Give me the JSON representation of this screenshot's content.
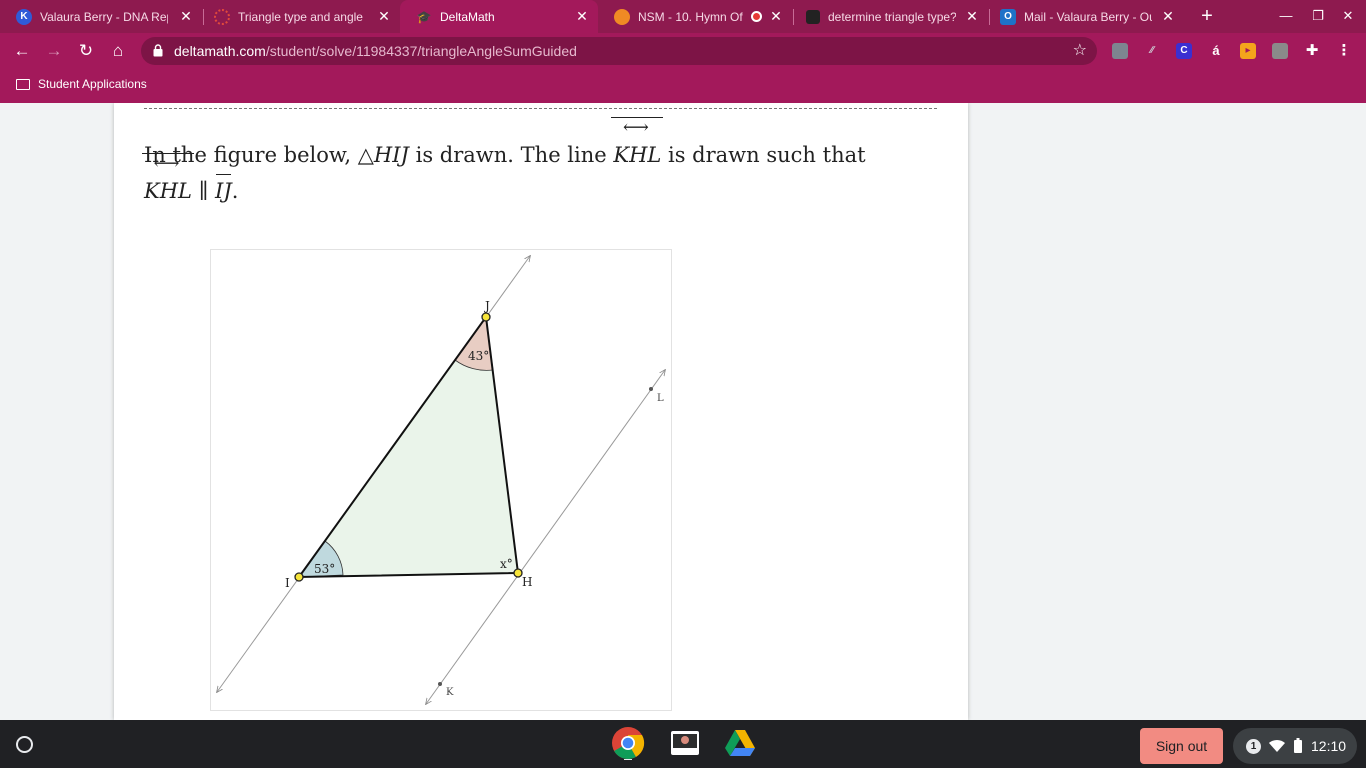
{
  "tabs": [
    {
      "title": "Valaura Berry - DNA Rep",
      "icon": "k-icon",
      "icon_letter": "K",
      "color": "#2f5bd8"
    },
    {
      "title": "Triangle type and angle",
      "icon": "red-ring-icon",
      "icon_letter": "",
      "color": "#e24a3b"
    },
    {
      "title": "DeltaMath",
      "icon": "graduation-cap-icon",
      "icon_letter": "",
      "color": "#ffffff",
      "active": true
    },
    {
      "title": "NSM - 10. Hymn Of",
      "icon": "orange-music-icon",
      "icon_letter": "",
      "color": "#f08a24",
      "recording": true
    },
    {
      "title": "determine triangle type?",
      "icon": "brainly-icon",
      "icon_letter": "",
      "color": "#222222"
    },
    {
      "title": "Mail - Valaura Berry - Ou",
      "icon": "outlook-icon",
      "icon_letter": "O",
      "color": "#1e72c8"
    }
  ],
  "address": {
    "host": "deltamath.com",
    "path": "/student/solve/11984337/triangleAngleSumGuided"
  },
  "bookmarks": [
    {
      "label": "Student Applications"
    }
  ],
  "problem": {
    "intro": "In the figure below,",
    "triangle_symbol": "△",
    "triangle_name": "HIJ",
    "mid": "is drawn. The line",
    "line_name": "KHL",
    "tail": "is drawn such that",
    "parallel": "∥",
    "segment_name": "IJ",
    "period": "."
  },
  "figure": {
    "vertices": {
      "J": "J",
      "I": "I",
      "H": "H"
    },
    "line_points": {
      "K": "K",
      "L": "L"
    },
    "angles": {
      "J": "43°",
      "I": "53°",
      "H": "x°"
    }
  },
  "shelf": {
    "sign_out": "Sign out",
    "notifications": "1",
    "time": "12:10"
  }
}
